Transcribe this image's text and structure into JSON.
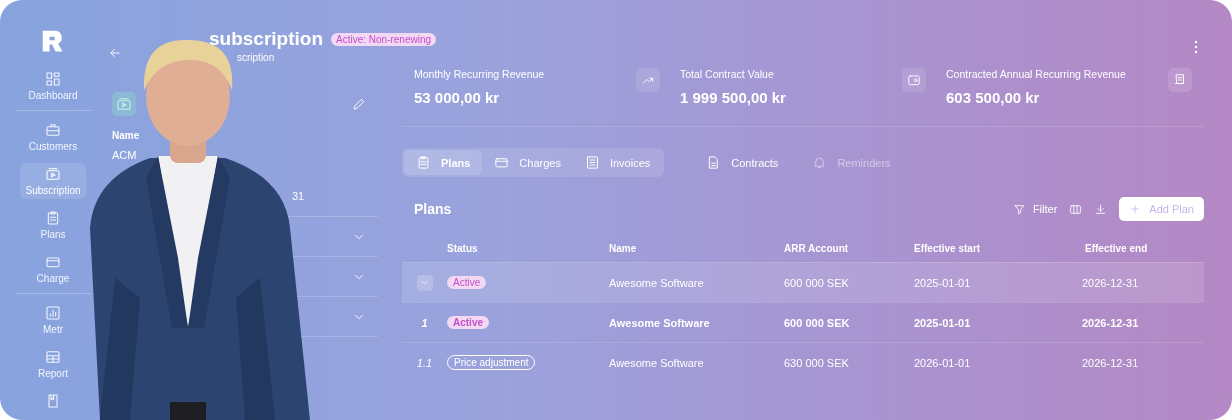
{
  "sidebar": {
    "items": [
      {
        "label": "Dashboard",
        "selected": false
      },
      {
        "label": "Customers",
        "selected": false
      },
      {
        "label": "Subscription",
        "selected": true
      },
      {
        "label": "Plans",
        "selected": false
      },
      {
        "label": "Charge",
        "selected": false
      },
      {
        "label": "Metr",
        "selected": false
      },
      {
        "label": "Report",
        "selected": false
      },
      {
        "selected": false
      }
    ]
  },
  "header": {
    "title": "subscription",
    "status": "Active: Non-renewing",
    "subtitle": "scription"
  },
  "details": {
    "name_label": "Name",
    "name_value": "ACM",
    "date_fragment": "31",
    "sections": [
      {
        "expanded": false
      },
      {
        "expanded": false
      },
      {
        "expanded": false
      }
    ]
  },
  "stats": [
    {
      "label": "Monthly Recurring Revenue",
      "value": "53 000,00 kr"
    },
    {
      "label": "Total Contract Value",
      "value": "1 999 500,00 kr"
    },
    {
      "label": "Contracted Annual Recurring Revenue",
      "value": "603 500,00 kr"
    }
  ],
  "tab_groups": [
    {
      "tabs": [
        {
          "label": "Plans",
          "selected": true,
          "disabled": false
        },
        {
          "label": "Charges",
          "selected": false,
          "disabled": false
        },
        {
          "label": "Invoices",
          "selected": false,
          "disabled": false
        }
      ]
    },
    {
      "tabs": [
        {
          "label": "Contracts",
          "selected": false,
          "disabled": false
        },
        {
          "label": "Reminders",
          "selected": false,
          "disabled": true
        }
      ]
    }
  ],
  "plans": {
    "title": "Plans",
    "filter": "Filter",
    "add_button": "Add Plan",
    "columns": [
      "Status",
      "Name",
      "ARR Account",
      "Effective start",
      "Effective end"
    ],
    "rows": [
      {
        "expanded": true,
        "selected": true,
        "bold": false,
        "kind": "filled",
        "cells": [
          "Active",
          "Awesome Software",
          "600 000 SEK",
          "2025-01-01",
          "2026-12-31"
        ]
      },
      {
        "index": "1",
        "expanded": false,
        "selected": false,
        "bold": true,
        "kind": "filled",
        "cells": [
          "Active",
          "Awesome Software",
          "600 000 SEK",
          "2025-01-01",
          "2026-12-31"
        ]
      },
      {
        "index": "1.1",
        "expanded": false,
        "selected": false,
        "bold": false,
        "kind": "outline",
        "cells": [
          "Price adjustment",
          "Awesome Software",
          "630 000 SEK",
          "2026-01-01",
          "2026-12-31"
        ]
      }
    ]
  }
}
